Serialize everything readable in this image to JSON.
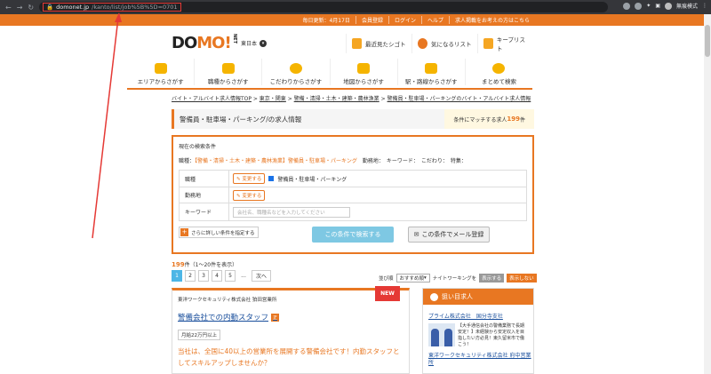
{
  "browser": {
    "url_host": "domonet.jp",
    "url_path": "/kanto/list/job%5B%5D=0701",
    "profile_label": "無痕模式"
  },
  "topbar": {
    "items": [
      "毎日更新：4月17日",
      "会員登録",
      "ログイン",
      "ヘルプ",
      "求人掲載をお考えの方はこちら"
    ]
  },
  "header": {
    "logo_a": "DO",
    "logo_b": "MO!",
    "logo_net": "NET",
    "region": "東日本",
    "recent": "最近見たシゴト",
    "favorite": "気になるリスト",
    "keeplist": "キープリスト"
  },
  "menu": [
    "エリアからさがす",
    "職種からさがす",
    "こだわりからさがす",
    "地図からさがす",
    "駅・路線からさがす",
    "まとめて検索"
  ],
  "breadcrumb": [
    "バイト・アルバイト求人情報TOP",
    "東京・関東",
    "警備・清掃・土木・建築・農林漁業",
    "警備員・駐車場・パーキングのバイト・アルバイト求人情報"
  ],
  "page": {
    "title": "警備員・駐車場・パーキング/の求人情報",
    "count_prefix": "条件にマッチする求人",
    "count_value": "199",
    "count_suffix": "件"
  },
  "search": {
    "heading": "現在の検索条件",
    "cond_label": "職種：",
    "cond_value": "【警備・清掃・土木・建築・農林漁業】警備員・駐車場・パーキング",
    "cond_rest": "勤務地：　キーワード：　こだわり：　特集：",
    "row_job": "職種",
    "row_area": "勤務地",
    "row_keyword": "キーワード",
    "change": "変更する",
    "job_selected": "警備員・駐車場・パーキング",
    "keyword_placeholder": "会社名、職種名などを入力してください",
    "detail_link": "さらに詳しい条件を指定する",
    "search_button": "この条件で検索する",
    "mail_button": "この条件でメール登録"
  },
  "results": {
    "total": "199",
    "total_suffix": "件（1〜20件を表示）",
    "pages": [
      "1",
      "2",
      "3",
      "4",
      "5",
      "...",
      "次へ"
    ],
    "sort_label": "並び順",
    "sort_value": "おすすめ順",
    "night_label": "ナイトワーキングを",
    "show": "表示する",
    "hide": "表示しない"
  },
  "job": {
    "company": "東洋ワークセキュリティ株式会社 狛田営業所",
    "title": "警備会社での内勤スタッフ",
    "tag": "正",
    "badge": "NEW",
    "salary": "月給22万円以上",
    "catch": "当社は、全国に40以上の営業所を展開する警備会社です！内勤スタッフとしてスキルアップしませんか？"
  },
  "sidebar": {
    "heading": "狙い目求人",
    "company1": "プライム株式会社　国分寺支社",
    "desc1": "【大手通信会社の警備業務で長期安定！】未経験から安定収入を目指したい方必見！東久留米市で働こう！",
    "company2": "東洋ワークセキュリティ株式会社 府中営業所"
  }
}
